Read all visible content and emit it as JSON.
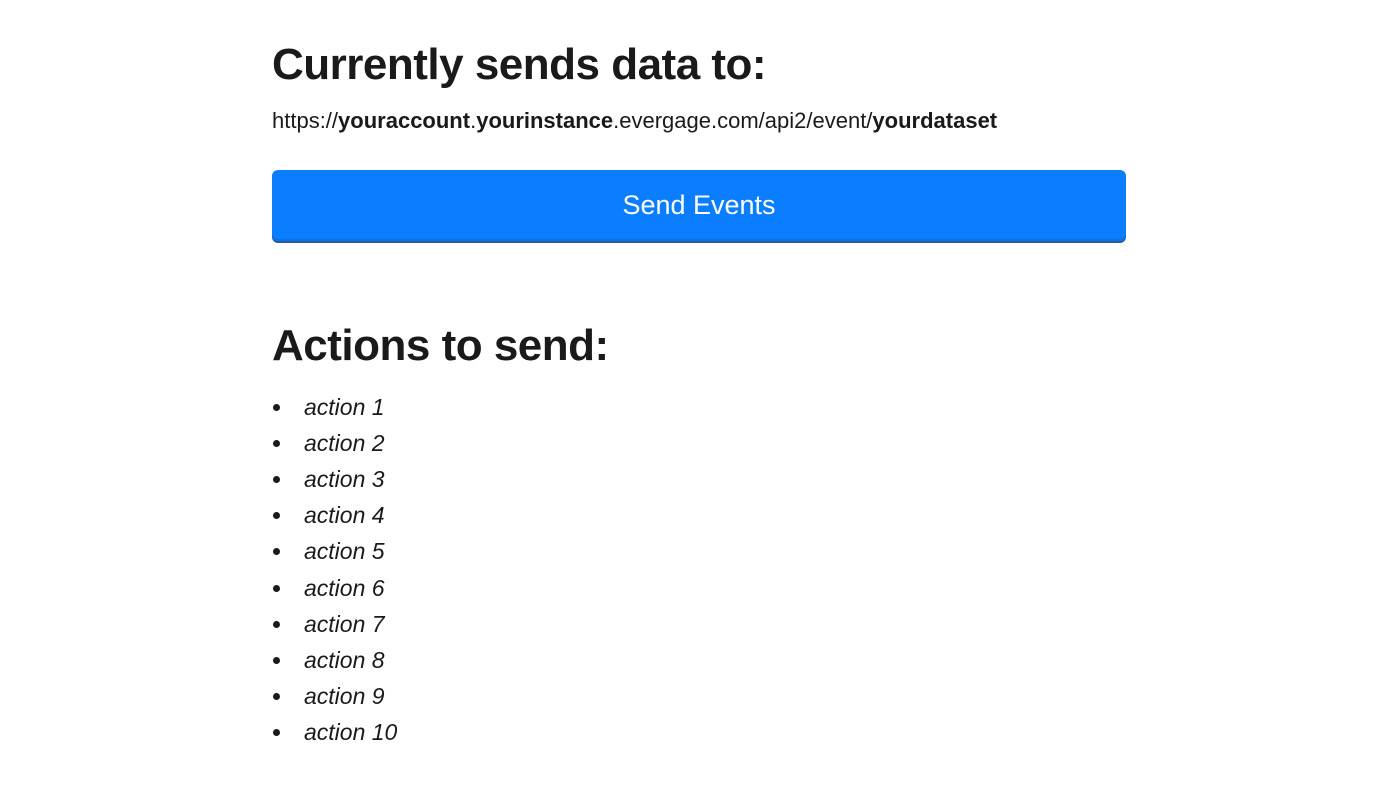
{
  "header": {
    "title": "Currently sends data to:",
    "url_prefix": "https://",
    "url_account": "youraccount",
    "url_dot1": ".",
    "url_instance": "yourinstance",
    "url_mid": ".evergage.com/api2/event/",
    "url_dataset": "yourdataset"
  },
  "button": {
    "label": "Send Events"
  },
  "actions": {
    "title": "Actions to send:",
    "items": [
      "action 1",
      "action 2",
      "action 3",
      "action 4",
      "action 5",
      "action 6",
      "action 7",
      "action 8",
      "action 9",
      "action 10"
    ]
  }
}
